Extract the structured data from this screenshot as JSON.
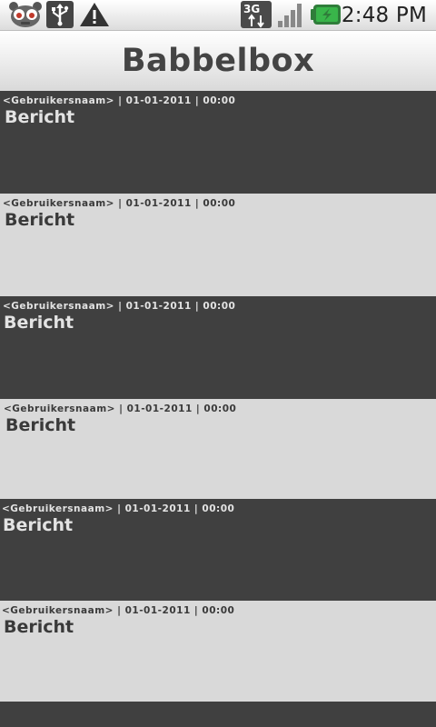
{
  "status_bar": {
    "time": "2:48 PM",
    "network": "3G",
    "icons": [
      "app-notification-icon",
      "usb-icon",
      "warning-icon",
      "3g-data-icon",
      "signal-icon",
      "battery-charging-icon"
    ]
  },
  "app": {
    "title": "Babbelbox"
  },
  "messages": [
    {
      "meta": "<Gebruikersnaam> | 01-01-2011 | 00:00",
      "text": "Bericht"
    },
    {
      "meta": "<Gebruikersnaam> | 01-01-2011 | 00:00",
      "text": "Bericht"
    },
    {
      "meta": "<Gebruikersnaam> | 01-01-2011 | 00:00",
      "text": "Bericht"
    },
    {
      "meta": "<Gebruikersnaam> | 01-01-2011 | 00:00",
      "text": "Bericht"
    },
    {
      "meta": "<Gebruikersnaam> | 01-01-2011 | 00:00",
      "text": "Bericht"
    },
    {
      "meta": "<Gebruikersnaam> | 01-01-2011 | 00:00",
      "text": "Bericht"
    }
  ],
  "colors": {
    "dark_row": "#404040",
    "light_row": "#d9d9d9",
    "title_text": "#444444",
    "battery_green": "#39b54a"
  }
}
